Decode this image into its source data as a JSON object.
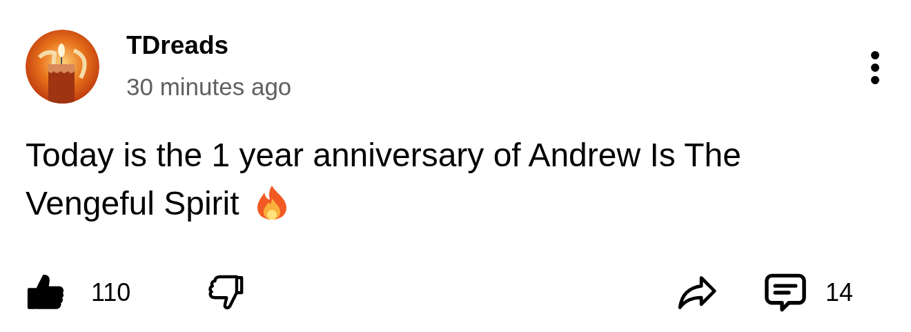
{
  "post": {
    "author": "TDreads",
    "time": "30 minutes ago",
    "text_lines": [
      "Today is the 1 year anniversary of Andrew Is The",
      "Vengeful Spirit"
    ]
  },
  "actions": {
    "liked": true,
    "disliked": false,
    "like_count": "110",
    "comment_count": "14"
  }
}
